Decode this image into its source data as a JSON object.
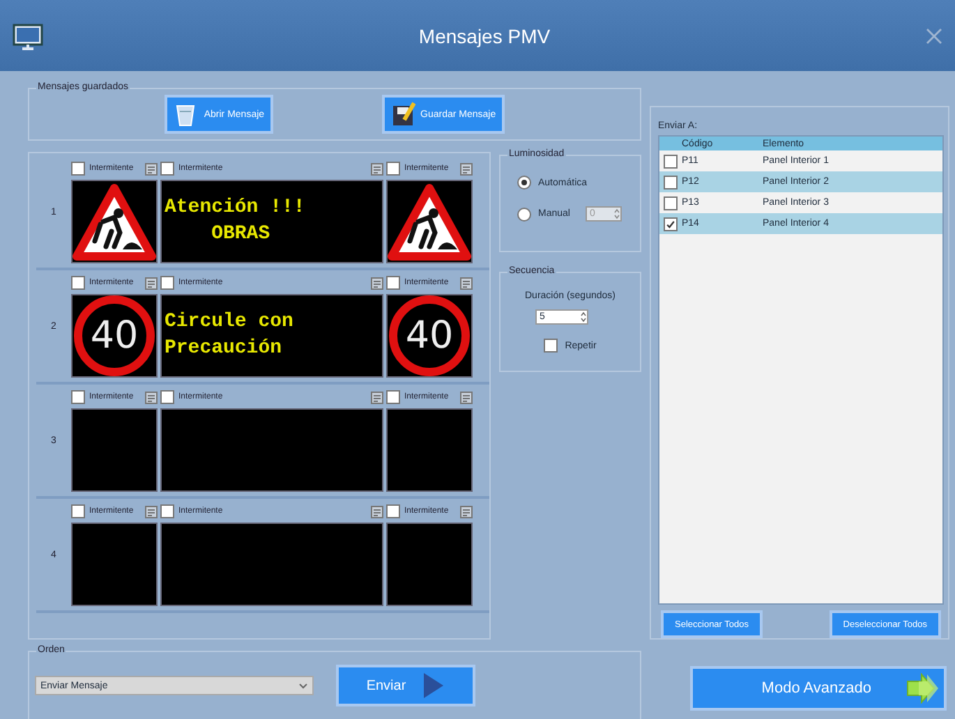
{
  "window": {
    "title": "Mensajes PMV"
  },
  "saved_messages": {
    "legend": "Mensajes guardados",
    "buttons": [
      {
        "label": "Abrir Mensaje",
        "kind": "open"
      },
      {
        "label": "Guardar Mensaje",
        "kind": "save"
      }
    ]
  },
  "panels": [
    {
      "number": "1",
      "cells": [
        {
          "kind": "work",
          "flash_label": "Intermitente",
          "flashing": false
        },
        {
          "kind": "text",
          "flash_label": "Intermitente",
          "flashing": false,
          "lines": [
            "Atención !!!",
            "    OBRAS"
          ]
        },
        {
          "kind": "work",
          "flash_label": "Intermitente",
          "flashing": false
        }
      ]
    },
    {
      "number": "2",
      "cells": [
        {
          "kind": "speed",
          "text": "40",
          "flash_label": "Intermitente",
          "flashing": false
        },
        {
          "kind": "text",
          "flash_label": "Intermitente",
          "flashing": false,
          "lines": [
            "Circule con",
            "Precaución"
          ]
        },
        {
          "kind": "speed",
          "text": "40",
          "flash_label": "Intermitente",
          "flashing": false
        }
      ]
    },
    {
      "number": "3",
      "cells": [
        {
          "kind": "blank",
          "flash_label": "Intermitente",
          "flashing": false
        },
        {
          "kind": "blank",
          "flash_label": "Intermitente",
          "flashing": false
        },
        {
          "kind": "blank",
          "flash_label": "Intermitente",
          "flashing": false
        }
      ]
    },
    {
      "number": "4",
      "cells": [
        {
          "kind": "blank",
          "flash_label": "Intermitente",
          "flashing": false
        },
        {
          "kind": "blank",
          "flash_label": "Intermitente",
          "flashing": false
        },
        {
          "kind": "blank",
          "flash_label": "Intermitente",
          "flashing": false
        }
      ]
    }
  ],
  "luminosity": {
    "legend": "Luminosidad",
    "options": [
      {
        "label": "Automática",
        "selected": true
      },
      {
        "label": "Manual",
        "selected": false
      }
    ],
    "manual_value": "0"
  },
  "sequence": {
    "legend": "Secuencia",
    "duration_label": "Duración (segundos)",
    "duration": "5",
    "repeat_label": "Repetir",
    "repeat": false
  },
  "send_to": {
    "legend": "Enviar A:",
    "columns": [
      "Código",
      "Elemento"
    ],
    "rows": [
      {
        "code": "P11",
        "element": "Panel Interior 1",
        "checked": false
      },
      {
        "code": "P12",
        "element": "Panel Interior 2",
        "checked": false
      },
      {
        "code": "P13",
        "element": "Panel Interior 3",
        "checked": false
      },
      {
        "code": "P14",
        "element": "Panel Interior 4",
        "checked": true
      }
    ],
    "buttons": [
      "Seleccionar Todos",
      "Deseleccionar Todos"
    ]
  },
  "order": {
    "legend": "Orden",
    "value": "Enviar Mensaje",
    "send_button": "Enviar"
  },
  "advanced_button": "Modo Avanzado"
}
